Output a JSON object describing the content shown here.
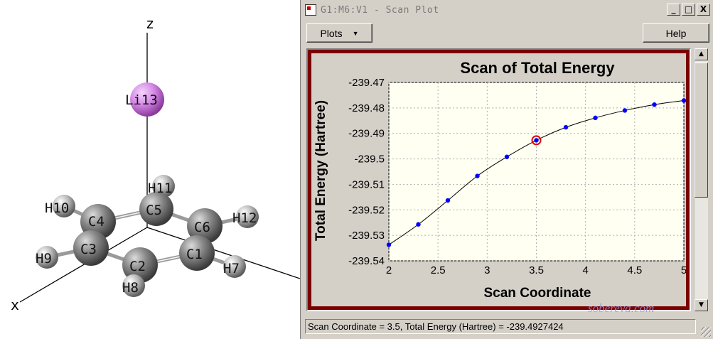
{
  "viewer": {
    "axis_z": "z",
    "axis_x": "x",
    "atoms": {
      "li13": "Li13",
      "h11": "H11",
      "c5": "C5",
      "h10": "H10",
      "c4": "C4",
      "c6": "C6",
      "h12": "H12",
      "h9": "H9",
      "c3": "C3",
      "c1": "C1",
      "c2": "C2",
      "h7": "H7",
      "h8": "H8"
    },
    "colors": {
      "lithium": "#d78ae8",
      "carbon": "#6e6e6e",
      "hydrogen": "#bdbdbd"
    }
  },
  "window": {
    "title": "G1:M6:V1 - Scan Plot",
    "minimize_label": "_",
    "maximize_label": "□",
    "close_label": "X"
  },
  "toolbar": {
    "plots_label": "Plots",
    "plots_arrow": "▼",
    "help_label": "Help"
  },
  "scrollbar": {
    "up_arrow": "▲",
    "down_arrow": "▼"
  },
  "watermark": "sobereva.com",
  "status": {
    "text": "Scan Coordinate = 3.5, Total Energy (Hartree) = -239.4927424"
  },
  "chart_data": {
    "type": "line",
    "title": "Scan of Total Energy",
    "xlabel": "Scan Coordinate",
    "ylabel": "Total Energy (Hartree)",
    "xlim": [
      2,
      5
    ],
    "ylim": [
      -239.54,
      -239.47
    ],
    "xticks": [
      "2",
      "2.5",
      "3",
      "3.5",
      "4",
      "4.5",
      "5"
    ],
    "yticks": [
      "-239.47",
      "-239.48",
      "-239.49",
      "-239.5",
      "-239.51",
      "-239.52",
      "-239.53",
      "-239.54"
    ],
    "grid": true,
    "x": [
      2.0,
      2.3,
      2.6,
      2.9,
      3.2,
      3.5,
      3.8,
      4.1,
      4.4,
      4.7,
      5.0
    ],
    "values": [
      -239.5337,
      -239.5257,
      -239.5163,
      -239.5067,
      -239.4992,
      -239.4927,
      -239.4876,
      -239.4839,
      -239.481,
      -239.4787,
      -239.4771
    ],
    "highlight_index": 5,
    "colors": {
      "line": "#000000",
      "point": "#0000ff",
      "highlight": "#e00000",
      "background": "#fffff2",
      "grid": "#b0b0b0"
    }
  }
}
